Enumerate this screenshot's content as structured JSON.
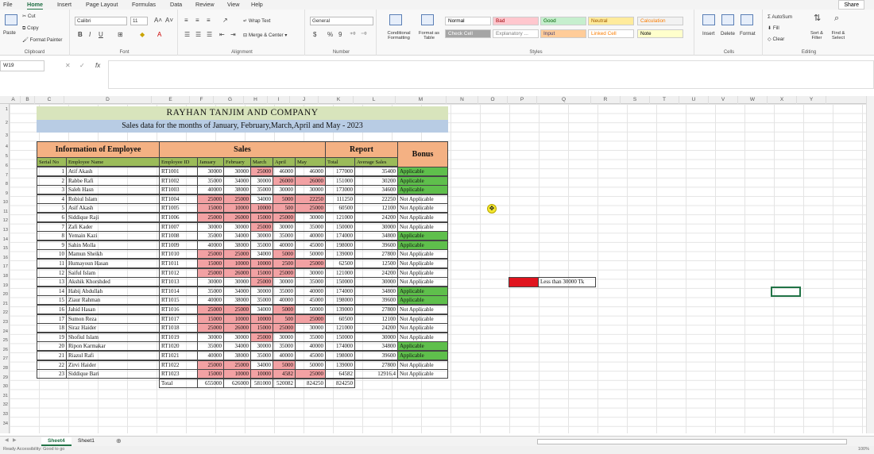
{
  "menu": [
    "File",
    "Home",
    "Insert",
    "Page Layout",
    "Formulas",
    "Data",
    "Review",
    "View",
    "Help"
  ],
  "share_label": "Share",
  "ribbon": {
    "clipboard": {
      "paste": "Paste",
      "cut": "Cut",
      "copy": "Copy",
      "format_painter": "Format Painter",
      "label": "Clipboard"
    },
    "font": {
      "name": "Calibri",
      "size": "11",
      "label": "Font"
    },
    "alignment": {
      "wrap": "Wrap Text",
      "merge": "Merge & Center",
      "label": "Alignment"
    },
    "number": {
      "format": "General",
      "label": "Number"
    },
    "styles": {
      "conditional": "Conditional Formatting",
      "format_table": "Format as Table",
      "cells": [
        {
          "label": "Normal",
          "bg": "#ffffff",
          "fg": "#000000"
        },
        {
          "label": "Bad",
          "bg": "#ffc7ce",
          "fg": "#9c0006"
        },
        {
          "label": "Good",
          "bg": "#c6efce",
          "fg": "#006100"
        },
        {
          "label": "Neutral",
          "bg": "#ffeb9c",
          "fg": "#9c5700"
        },
        {
          "label": "Calculation",
          "bg": "#f2f2f2",
          "fg": "#fa7d00"
        },
        {
          "label": "Check Cell",
          "bg": "#a5a5a5",
          "fg": "#ffffff"
        },
        {
          "label": "Explanatory ...",
          "bg": "#ffffff",
          "fg": "#7f7f7f"
        },
        {
          "label": "Input",
          "bg": "#ffcc99",
          "fg": "#3f3f76"
        },
        {
          "label": "Linked Cell",
          "bg": "#ffffff",
          "fg": "#fa7d00"
        },
        {
          "label": "Note",
          "bg": "#ffffcc",
          "fg": "#000000"
        }
      ],
      "label": "Styles"
    },
    "cells": {
      "insert": "Insert",
      "delete": "Delete",
      "format": "Format",
      "label": "Cells"
    },
    "editing": {
      "autosum": "AutoSum",
      "fill": "Fill",
      "clear": "Clear",
      "sort": "Sort & Filter",
      "find": "Find & Select",
      "label": "Editing"
    }
  },
  "namebox": "W19",
  "columns": [
    "A",
    "B",
    "C",
    "D",
    "E",
    "F",
    "G",
    "H",
    "I",
    "J",
    "K",
    "L",
    "M",
    "N",
    "O",
    "P",
    "Q",
    "R",
    "S",
    "T",
    "U",
    "V",
    "W",
    "X",
    "Y"
  ],
  "rows": [
    "1",
    "2",
    "3",
    "4",
    "5",
    "6",
    "7",
    "8",
    "9",
    "10",
    "11",
    "12",
    "13",
    "14",
    "15",
    "16",
    "17",
    "18",
    "19",
    "20",
    "21",
    "22",
    "23",
    "24",
    "25",
    "26",
    "27",
    "28",
    "29",
    "30",
    "31",
    "32",
    "33",
    "34"
  ],
  "sheet": {
    "title": "RAYHAN TANJIM AND COMPANY",
    "subtitle": "Sales data for the months of January, February,March,April and May - 2023",
    "section_info": "Information of Employee",
    "section_sales": "Sales",
    "section_report": "Report",
    "section_bonus": "Bonus",
    "headers": [
      "Serial No",
      "Employee Name",
      "Employee ID",
      "January",
      "February",
      "March",
      "April",
      "May",
      "Total",
      "Average Sales"
    ],
    "employees": [
      {
        "sn": "1",
        "name": "Atif Akash",
        "id": "RT1001",
        "jan": "30000",
        "feb": "30000",
        "mar": "25000",
        "apr": "46000",
        "may": "46000",
        "total": "177000",
        "avg": "35400",
        "bonus": "Applicable"
      },
      {
        "sn": "2",
        "name": "Rabbe Rafi",
        "id": "RT1002",
        "jan": "35000",
        "feb": "34000",
        "mar": "30000",
        "apr": "26000",
        "may": "26000",
        "total": "151000",
        "avg": "30200",
        "bonus": "Applicable"
      },
      {
        "sn": "3",
        "name": "Saleh Hasn",
        "id": "RT1003",
        "jan": "40000",
        "feb": "38000",
        "mar": "35000",
        "apr": "30000",
        "may": "30000",
        "total": "173000",
        "avg": "34600",
        "bonus": "Applicable"
      },
      {
        "sn": "4",
        "name": "Robiul Islam",
        "id": "RT1004",
        "jan": "25000",
        "feb": "25000",
        "mar": "34000",
        "apr": "5000",
        "may": "22250",
        "total": "111250",
        "avg": "22250",
        "bonus": "Not Applicable"
      },
      {
        "sn": "5",
        "name": "Asif Akash",
        "id": "RT1005",
        "jan": "15000",
        "feb": "10000",
        "mar": "10000",
        "apr": "500",
        "may": "25000",
        "total": "60500",
        "avg": "12100",
        "bonus": "Not Applicable"
      },
      {
        "sn": "6",
        "name": "Siddique Raji",
        "id": "RT1006",
        "jan": "25000",
        "feb": "26000",
        "mar": "15000",
        "apr": "25000",
        "may": "30000",
        "total": "121000",
        "avg": "24200",
        "bonus": "Not Applicable"
      },
      {
        "sn": "7",
        "name": "Zafi Kader",
        "id": "RT1007",
        "jan": "30000",
        "feb": "30000",
        "mar": "25000",
        "apr": "30000",
        "may": "35000",
        "total": "150000",
        "avg": "30000",
        "bonus": "Not Applicable"
      },
      {
        "sn": "8",
        "name": "Yemain Kazi",
        "id": "RT1008",
        "jan": "35000",
        "feb": "34000",
        "mar": "30000",
        "apr": "35000",
        "may": "40000",
        "total": "174000",
        "avg": "34800",
        "bonus": "Applicable"
      },
      {
        "sn": "9",
        "name": "Sahin Molla",
        "id": "RT1009",
        "jan": "40000",
        "feb": "38000",
        "mar": "35000",
        "apr": "40000",
        "may": "45000",
        "total": "198000",
        "avg": "39600",
        "bonus": "Applicable"
      },
      {
        "sn": "10",
        "name": "Mamun Sheikh",
        "id": "RT1010",
        "jan": "25000",
        "feb": "25000",
        "mar": "34000",
        "apr": "5000",
        "may": "50000",
        "total": "139000",
        "avg": "27800",
        "bonus": "Not Applicable"
      },
      {
        "sn": "11",
        "name": "Humayoun Hasan",
        "id": "RT1011",
        "jan": "15000",
        "feb": "10000",
        "mar": "10000",
        "apr": "2500",
        "may": "25000",
        "total": "62500",
        "avg": "12500",
        "bonus": "Not Applicable"
      },
      {
        "sn": "12",
        "name": "Saiful Islam",
        "id": "RT1012",
        "jan": "25000",
        "feb": "26000",
        "mar": "15000",
        "apr": "25000",
        "may": "30000",
        "total": "121000",
        "avg": "24200",
        "bonus": "Not Applicable"
      },
      {
        "sn": "13",
        "name": "Akshik Khorshded",
        "id": "RT1013",
        "jan": "30000",
        "feb": "30000",
        "mar": "25000",
        "apr": "30000",
        "may": "35000",
        "total": "150000",
        "avg": "30000",
        "bonus": "Not Applicable"
      },
      {
        "sn": "14",
        "name": "Habij Abdullah",
        "id": "RT1014",
        "jan": "35000",
        "feb": "34000",
        "mar": "30000",
        "apr": "35000",
        "may": "40000",
        "total": "174000",
        "avg": "34800",
        "bonus": "Applicable"
      },
      {
        "sn": "15",
        "name": "Ziaur Rahman",
        "id": "RT1015",
        "jan": "40000",
        "feb": "38000",
        "mar": "35000",
        "apr": "40000",
        "may": "45000",
        "total": "198000",
        "avg": "39600",
        "bonus": "Applicable"
      },
      {
        "sn": "16",
        "name": "Jahid Hasan",
        "id": "RT1016",
        "jan": "25000",
        "feb": "25000",
        "mar": "34000",
        "apr": "5000",
        "may": "50000",
        "total": "139000",
        "avg": "27800",
        "bonus": "Not Applicable"
      },
      {
        "sn": "17",
        "name": "Sumon Reza",
        "id": "RT1017",
        "jan": "15000",
        "feb": "10000",
        "mar": "10000",
        "apr": "500",
        "may": "25000",
        "total": "60500",
        "avg": "12100",
        "bonus": "Not Applicable"
      },
      {
        "sn": "18",
        "name": "Siraz Haider",
        "id": "RT1018",
        "jan": "25000",
        "feb": "26000",
        "mar": "15000",
        "apr": "25000",
        "may": "30000",
        "total": "121000",
        "avg": "24200",
        "bonus": "Not Applicable"
      },
      {
        "sn": "19",
        "name": "Shofiul Islam",
        "id": "RT1019",
        "jan": "30000",
        "feb": "30000",
        "mar": "25000",
        "apr": "30000",
        "may": "35000",
        "total": "150000",
        "avg": "30000",
        "bonus": "Not Applicable"
      },
      {
        "sn": "20",
        "name": "Ripon Karmakar",
        "id": "RT1020",
        "jan": "35000",
        "feb": "34000",
        "mar": "30000",
        "apr": "35000",
        "may": "40000",
        "total": "174000",
        "avg": "34800",
        "bonus": "Applicable"
      },
      {
        "sn": "21",
        "name": "Riazul Rafi",
        "id": "RT1021",
        "jan": "40000",
        "feb": "38000",
        "mar": "35000",
        "apr": "40000",
        "may": "45000",
        "total": "198000",
        "avg": "39600",
        "bonus": "Applicable"
      },
      {
        "sn": "22",
        "name": "Zirvi Haider",
        "id": "RT1022",
        "jan": "25000",
        "feb": "25000",
        "mar": "34000",
        "apr": "5000",
        "may": "50000",
        "total": "139000",
        "avg": "27800",
        "bonus": "Not Applicable"
      },
      {
        "sn": "23",
        "name": "Siddique Bari",
        "id": "RT1023",
        "jan": "15000",
        "feb": "10000",
        "mar": "10000",
        "apr": "4582",
        "may": "25000",
        "total": "64582",
        "avg": "12916.4",
        "bonus": "Not Applicable"
      }
    ],
    "total_label": "Total",
    "totals": {
      "jan": "655000",
      "feb": "626000",
      "mar": "581000",
      "apr": "520082",
      "may": "824250",
      "total": "824250"
    },
    "legend_text": "Less than 30000 Tk",
    "colors": {
      "title_bg": "#d8e4bc",
      "subtitle_bg": "#b8cce4",
      "header_bg": "#f4b183",
      "subheader_bg": "#9bbb59",
      "red": "#f2a1a3",
      "green": "#5fbf4c",
      "legend_red": "#e0141e"
    }
  },
  "tabs": [
    "Sheet4",
    "Sheet1"
  ],
  "status": "Ready    Accessibility: Good to go",
  "zoom": "100%"
}
